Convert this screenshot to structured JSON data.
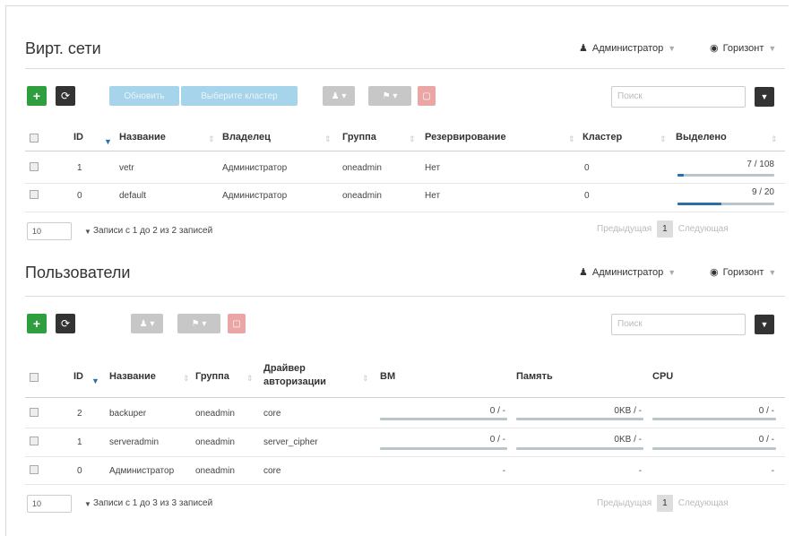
{
  "vnets": {
    "title": "Вирт. сети",
    "user_label": "Администратор",
    "zone_label": "Горизонт",
    "btn_refresh": "Обновить",
    "btn_select_cluster": "Выберите кластер",
    "search_placeholder": "Поиск",
    "columns": [
      "ID",
      "Название",
      "Владелец",
      "Группа",
      "Резервирование",
      "Кластер",
      "Выделено"
    ],
    "rows": [
      {
        "id": "1",
        "name": "vetr",
        "owner": "Администратор",
        "group": "oneadmin",
        "reservation": "Нет",
        "cluster": "0",
        "allocated": "7 / 108",
        "fraction": 0.065
      },
      {
        "id": "0",
        "name": "default",
        "owner": "Администратор",
        "group": "oneadmin",
        "reservation": "Нет",
        "cluster": "0",
        "allocated": "9 / 20",
        "fraction": 0.45
      }
    ],
    "page_size": "10",
    "info": "Записи с 1 до 2 из 2 записей",
    "prev": "Предыдущая",
    "page": "1",
    "next": "Следующая"
  },
  "users": {
    "title": "Пользователи",
    "user_label": "Администратор",
    "zone_label": "Горизонт",
    "search_placeholder": "Поиск",
    "columns": [
      "ID",
      "Название",
      "Группа",
      "Драйвер авторизации",
      "ВМ",
      "Память",
      "CPU"
    ],
    "auth_col_line1": "Драйвер",
    "auth_col_line2": "авторизации",
    "rows": [
      {
        "id": "2",
        "name": "backuper",
        "group": "oneadmin",
        "auth": "core",
        "vm": "0 / -",
        "mem": "0KB / -",
        "cpu": "0 / -"
      },
      {
        "id": "1",
        "name": "serveradmin",
        "group": "oneadmin",
        "auth": "server_cipher",
        "vm": "0 / -",
        "mem": "0KB / -",
        "cpu": "0 / -"
      },
      {
        "id": "0",
        "name": "Администратор",
        "group": "oneadmin",
        "auth": "core",
        "vm": "-",
        "mem": "-",
        "cpu": "-"
      }
    ],
    "page_size": "10",
    "info": "Записи с 1 до 3 из 3 записей",
    "prev": "Предыдущая",
    "page": "1",
    "next": "Следующая"
  },
  "colors": {
    "accent": "#2a6fa8",
    "create": "#2e9e3f",
    "delete": "#eaa5a5"
  }
}
